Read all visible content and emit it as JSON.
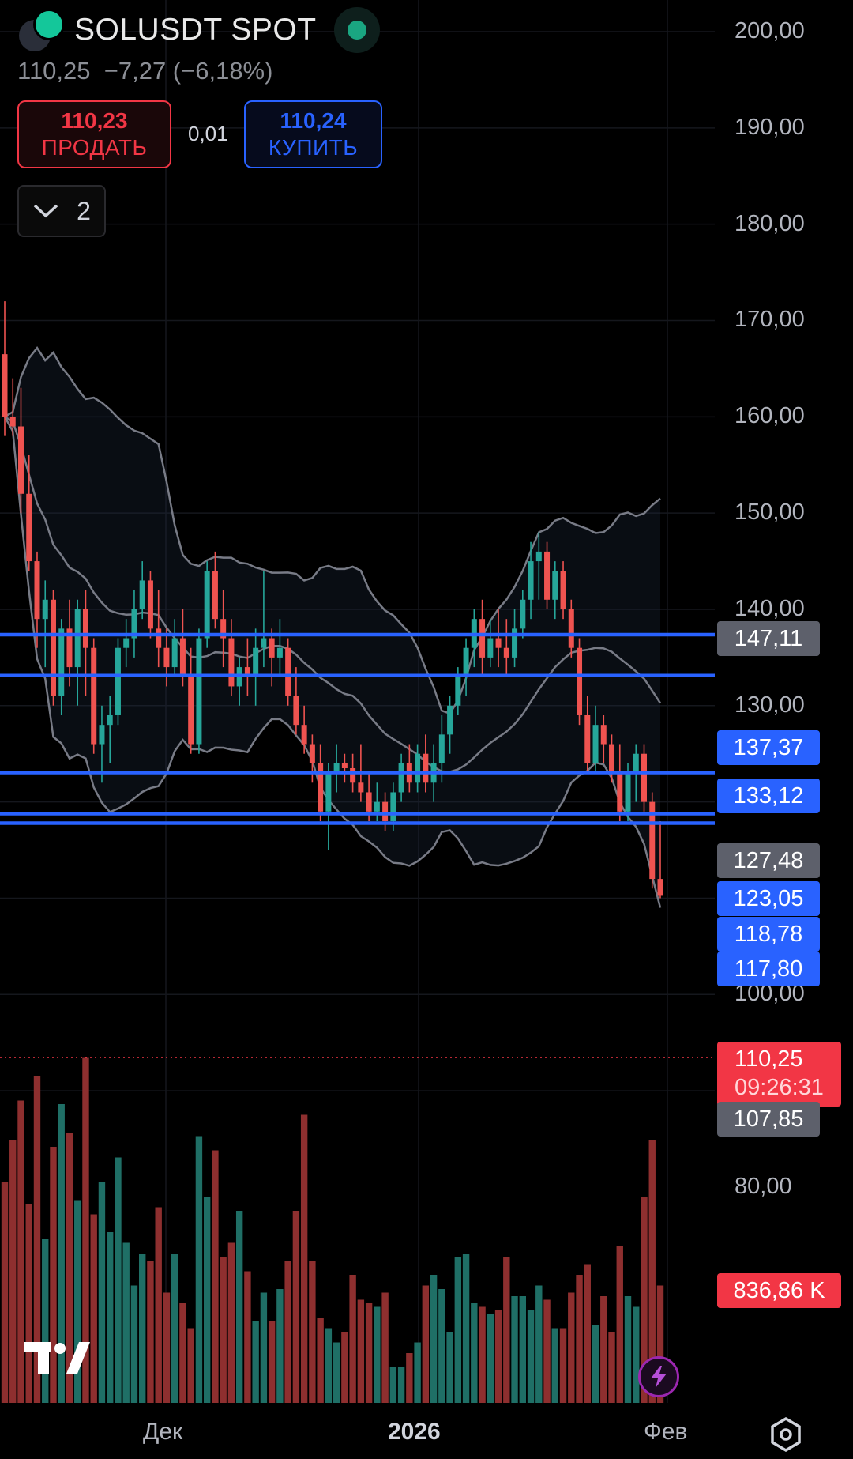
{
  "header": {
    "symbol": "SOLUSDT SPOT",
    "price_change_line": "110,25  −7,27 (−6,18%)",
    "sell": {
      "price": "110,23",
      "label": "ПРОДАТЬ"
    },
    "spread": "0,01",
    "buy": {
      "price": "110,24",
      "label": "КУПИТЬ"
    },
    "indicators_count": "2"
  },
  "price_axis": {
    "labels": [
      "200,00",
      "190,00",
      "180,00",
      "170,00",
      "160,00",
      "150,00",
      "140,00",
      "130,00",
      "100,00",
      "80,00"
    ],
    "label_values": [
      200,
      190,
      180,
      170,
      160,
      150,
      140,
      130,
      100,
      80
    ]
  },
  "price_tags": {
    "bb_upper": "147,11",
    "level_1": "137,37",
    "level_2": "133,12",
    "bb_middle": "127,48",
    "level_3": "123,05",
    "level_4": "118,78",
    "level_5": "117,80",
    "bb_lower": "107,85",
    "volume": "836,86 K"
  },
  "current_price": {
    "value": "110,25",
    "countdown": "09:26:31"
  },
  "time_axis": {
    "dec": "Дек",
    "year": "2026",
    "feb": "Фев"
  },
  "colors": {
    "up": "#26a69a",
    "down": "#ef5350",
    "level_line": "#2962ff",
    "band_line": "#787b86"
  },
  "chart_data": {
    "type": "candlestick",
    "horizontal_levels": [
      137.37,
      133.12,
      123.05,
      118.78,
      117.8
    ],
    "candles_ohlc": [
      [
        166.5,
        172,
        158,
        160
      ],
      [
        160,
        164,
        158,
        159
      ],
      [
        159,
        163,
        150,
        152
      ],
      [
        152,
        156,
        144,
        145
      ],
      [
        145,
        146,
        136,
        139
      ],
      [
        139,
        143,
        134,
        141
      ],
      [
        141,
        142,
        130,
        131
      ],
      [
        131,
        139,
        129,
        138
      ],
      [
        138,
        141,
        132,
        134
      ],
      [
        134,
        141,
        130,
        140
      ],
      [
        140,
        142,
        131,
        136
      ],
      [
        136,
        137,
        125,
        126
      ],
      [
        126,
        130,
        122,
        128
      ],
      [
        128,
        131,
        124,
        129
      ],
      [
        129,
        137,
        128,
        136
      ],
      [
        136,
        139,
        134,
        137
      ],
      [
        137,
        142,
        135,
        140
      ],
      [
        140,
        145,
        139,
        143
      ],
      [
        143,
        144,
        137,
        138
      ],
      [
        138,
        142,
        134,
        136
      ],
      [
        136,
        138,
        132,
        134
      ],
      [
        134,
        139,
        133,
        137
      ],
      [
        137,
        140,
        132,
        133
      ],
      [
        133,
        136,
        125,
        126
      ],
      [
        126,
        138,
        125,
        137
      ],
      [
        137,
        145,
        136,
        144
      ],
      [
        144,
        146,
        138,
        139
      ],
      [
        139,
        142,
        134,
        137
      ],
      [
        137,
        139,
        131,
        132
      ],
      [
        132,
        135,
        130,
        134
      ],
      [
        134,
        137,
        131,
        133
      ],
      [
        133,
        138,
        130,
        136
      ],
      [
        136,
        144,
        134,
        137
      ],
      [
        137,
        138,
        132,
        135
      ],
      [
        135,
        139,
        133,
        136
      ],
      [
        136,
        137,
        130,
        131
      ],
      [
        131,
        134,
        127,
        128
      ],
      [
        128,
        130,
        125,
        126
      ],
      [
        126,
        127,
        122,
        124
      ],
      [
        124,
        126,
        118,
        119
      ],
      [
        119,
        124,
        115,
        123
      ],
      [
        123,
        126,
        121,
        124
      ],
      [
        124,
        125,
        122,
        123.5
      ],
      [
        123.5,
        125,
        121,
        122
      ],
      [
        122,
        126,
        120,
        121
      ],
      [
        121,
        123,
        118,
        119
      ],
      [
        119,
        122,
        118,
        120
      ],
      [
        120,
        121,
        117,
        118
      ],
      [
        118,
        122,
        117,
        121
      ],
      [
        121,
        125,
        120,
        124
      ],
      [
        124,
        126,
        121,
        122
      ],
      [
        122,
        126,
        121,
        125
      ],
      [
        125,
        127,
        121,
        122
      ],
      [
        122,
        126,
        120,
        124
      ],
      [
        124,
        129,
        122,
        127
      ],
      [
        127,
        131,
        125,
        130
      ],
      [
        130,
        134,
        129,
        133
      ],
      [
        133,
        137,
        131,
        136
      ],
      [
        136,
        140,
        134,
        139
      ],
      [
        139,
        141,
        133,
        135
      ],
      [
        135,
        139,
        134,
        137
      ],
      [
        137,
        140,
        134,
        136
      ],
      [
        136,
        139,
        133,
        135
      ],
      [
        135,
        140,
        134,
        138
      ],
      [
        138,
        142,
        137,
        141
      ],
      [
        141,
        147,
        139,
        145
      ],
      [
        145,
        148,
        141,
        146
      ],
      [
        146,
        147,
        140,
        141
      ],
      [
        141,
        145,
        139,
        144
      ],
      [
        144,
        145,
        139,
        140
      ],
      [
        140,
        141,
        135,
        136
      ],
      [
        136,
        137,
        128,
        129
      ],
      [
        129,
        131,
        123,
        124
      ],
      [
        124,
        130,
        123,
        128
      ],
      [
        128,
        129,
        124,
        126
      ],
      [
        126,
        127,
        122,
        123
      ],
      [
        123,
        126,
        118,
        119
      ],
      [
        119,
        124,
        118,
        123
      ],
      [
        123,
        126,
        120,
        125
      ],
      [
        125,
        126,
        119,
        120
      ],
      [
        120,
        121,
        111,
        112
      ],
      [
        112,
        118,
        110,
        110.25
      ]
    ],
    "volumes": [
      0.62,
      0.74,
      0.85,
      0.56,
      0.92,
      0.46,
      0.72,
      0.84,
      0.76,
      0.57,
      0.97,
      0.53,
      0.62,
      0.48,
      0.69,
      0.45,
      0.33,
      0.42,
      0.4,
      0.55,
      0.31,
      0.42,
      0.28,
      0.21,
      0.75,
      0.58,
      0.71,
      0.41,
      0.45,
      0.54,
      0.37,
      0.23,
      0.31,
      0.23,
      0.32,
      0.4,
      0.54,
      0.81,
      0.4,
      0.24,
      0.21,
      0.17,
      0.2,
      0.36,
      0.29,
      0.28,
      0.27,
      0.31,
      0.1,
      0.1,
      0.14,
      0.17,
      0.33,
      0.36,
      0.32,
      0.2,
      0.41,
      0.42,
      0.28,
      0.27,
      0.25,
      0.26,
      0.41,
      0.3,
      0.3,
      0.26,
      0.33,
      0.29,
      0.21,
      0.21,
      0.31,
      0.36,
      0.39,
      0.22,
      0.3,
      0.2,
      0.44,
      0.3,
      0.27,
      0.58,
      0.74,
      0.33
    ]
  }
}
